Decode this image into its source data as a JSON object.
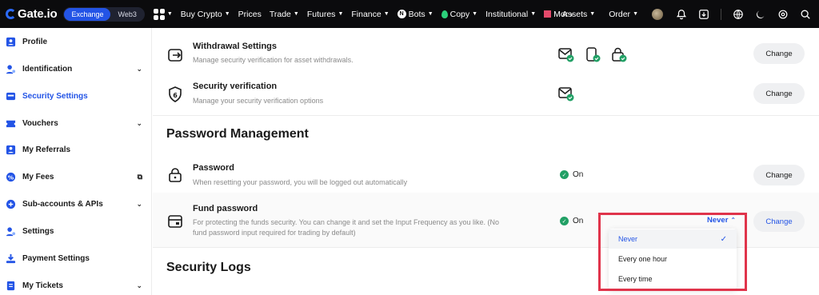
{
  "header": {
    "logo_text": "Gate.io",
    "segments": [
      "Exchange",
      "Web3"
    ],
    "nav": [
      "Buy Crypto",
      "Prices",
      "Trade",
      "Futures",
      "Finance",
      "Bots",
      "Copy",
      "Institutional",
      "Mor"
    ],
    "right": [
      "Assets",
      "Order"
    ]
  },
  "sidebar": {
    "items": [
      {
        "label": "Profile",
        "icon": "profile-icon",
        "expandable": false
      },
      {
        "label": "Identification",
        "icon": "id-icon",
        "expandable": true
      },
      {
        "label": "Security Settings",
        "icon": "shield-icon",
        "expandable": false,
        "active": true
      },
      {
        "label": "Vouchers",
        "icon": "voucher-icon",
        "expandable": true
      },
      {
        "label": "My Referrals",
        "icon": "referral-icon",
        "expandable": false
      },
      {
        "label": "My Fees",
        "icon": "fee-icon",
        "expandable": false,
        "external": true
      },
      {
        "label": "Sub-accounts & APIs",
        "icon": "subaccount-icon",
        "expandable": true
      },
      {
        "label": "Settings",
        "icon": "settings-icon",
        "expandable": false
      },
      {
        "label": "Payment Settings",
        "icon": "payment-icon",
        "expandable": false
      },
      {
        "label": "My Tickets",
        "icon": "ticket-icon",
        "expandable": true
      }
    ],
    "accent": "#2354e6"
  },
  "main": {
    "withdrawal": {
      "title": "Withdrawal Settings",
      "desc": "Manage security verification for asset withdrawals.",
      "button": "Change"
    },
    "verification": {
      "title": "Security verification",
      "desc": "Manage your security verification options",
      "button": "Change"
    },
    "password_section_title": "Password Management",
    "password": {
      "title": "Password",
      "desc": "When resetting your password, you will be logged out automatically",
      "status": "On",
      "button": "Change"
    },
    "fund_password": {
      "title": "Fund password",
      "desc_line1": "For protecting the funds security. You can change it and set the Input Frequency as you like. (No",
      "desc_line2": "fund password input required for trading by default)",
      "status": "On",
      "frequency_selected": "Never",
      "button": "Change",
      "options": [
        "Never",
        "Every one hour",
        "Every time"
      ]
    },
    "logs_section_title": "Security Logs"
  },
  "colors": {
    "topbar_bg": "#0b0b0d",
    "status_green": "#21a065",
    "highlight_red": "#e0344b"
  }
}
